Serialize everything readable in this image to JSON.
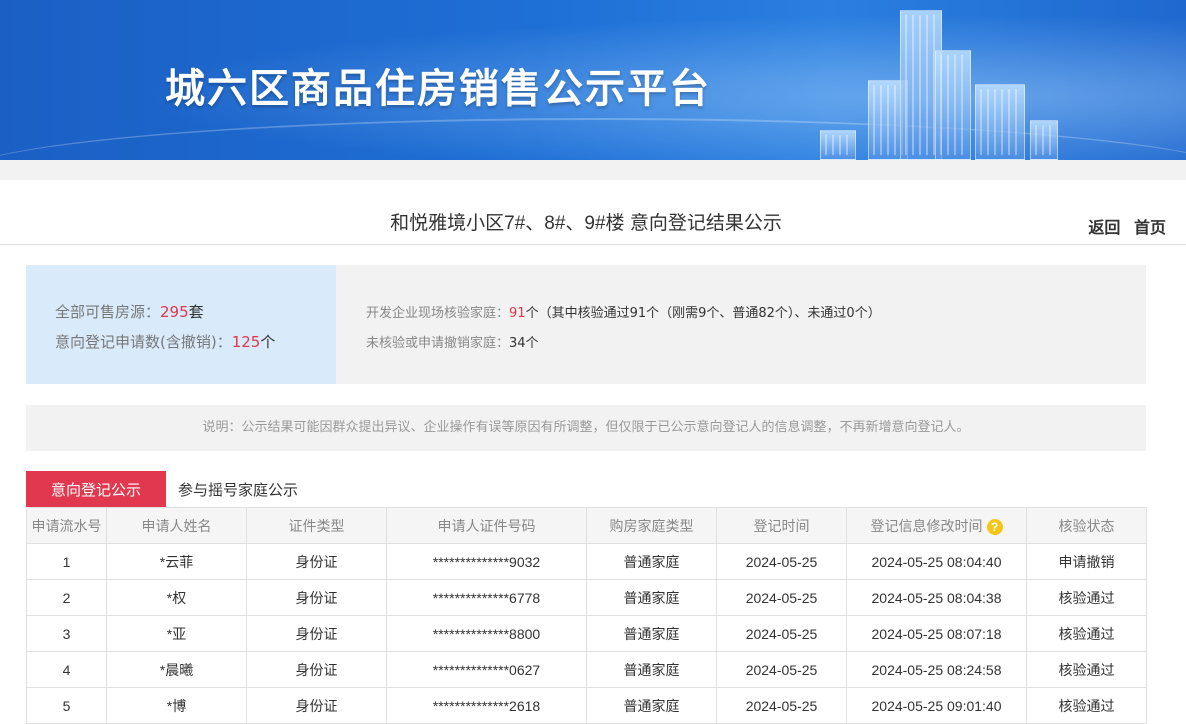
{
  "banner": {
    "title": "城六区商品住房销售公示平台"
  },
  "page": {
    "title": "和悦雅境小区7#、8#、9#楼 意向登记结果公示",
    "nav": {
      "back": "返回",
      "home": "首页"
    }
  },
  "stats": {
    "total_label": "全部可售房源：",
    "total_value": "295",
    "total_unit": "套",
    "apps_label": "意向登记申请数(含撤销)：",
    "apps_value": "125",
    "apps_unit": "个",
    "verified_label": "开发企业现场核验家庭：",
    "verified_value": "91",
    "verified_detail": "个（其中核验通过91个（刚需9个、普通82个）、未通过0个）",
    "unverified_label": "未核验或申请撤销家庭：",
    "unverified_value": "34个"
  },
  "note": "说明：公示结果可能因群众提出异议、企业操作有误等原因有所调整，但仅限于已公示意向登记人的信息调整，不再新增意向登记人。",
  "tabs": {
    "active": "意向登记公示",
    "other": "参与摇号家庭公示"
  },
  "table": {
    "headers": [
      "申请流水号",
      "申请人姓名",
      "证件类型",
      "申请人证件号码",
      "购房家庭类型",
      "登记时间",
      "登记信息修改时间",
      "核验状态"
    ],
    "help_icon": "question-icon",
    "rows": [
      [
        "1",
        "*云菲",
        "身份证",
        "**************9032",
        "普通家庭",
        "2024-05-25",
        "2024-05-25 08:04:40",
        "申请撤销"
      ],
      [
        "2",
        "*权",
        "身份证",
        "**************6778",
        "普通家庭",
        "2024-05-25",
        "2024-05-25 08:04:38",
        "核验通过"
      ],
      [
        "3",
        "*亚",
        "身份证",
        "**************8800",
        "普通家庭",
        "2024-05-25",
        "2024-05-25 08:07:18",
        "核验通过"
      ],
      [
        "4",
        "*晨曦",
        "身份证",
        "**************0627",
        "普通家庭",
        "2024-05-25",
        "2024-05-25 08:24:58",
        "核验通过"
      ],
      [
        "5",
        "*博",
        "身份证",
        "**************2618",
        "普通家庭",
        "2024-05-25",
        "2024-05-25 09:01:40",
        "核验通过"
      ]
    ]
  }
}
